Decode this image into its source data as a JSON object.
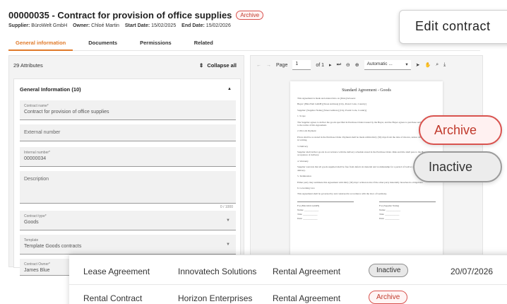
{
  "header": {
    "title": "00000035 - Contract for provision of office supplies",
    "status_badge": "Archive",
    "meta": {
      "supplier_label": "Supplier:",
      "supplier": "BüroWelt GmbH",
      "owner_label": "Owner:",
      "owner": "Chloé Martin",
      "start_label": "Start Date:",
      "start": "15/02/2025",
      "end_label": "End Date:",
      "end": "15/02/2026"
    }
  },
  "tabs": [
    {
      "label": "General information",
      "active": true
    },
    {
      "label": "Documents"
    },
    {
      "label": "Permissions"
    },
    {
      "label": "Related"
    }
  ],
  "left_panel": {
    "attributes_count": "29 Attributes",
    "collapse_label": "Collapse all",
    "section_title": "General Information (10)",
    "fields": {
      "contract_name": {
        "label": "Contract name*",
        "value": "Contract for provision of office supplies"
      },
      "external_number": {
        "placeholder": "External number"
      },
      "internal_number": {
        "label": "Internal number*",
        "value": "00000034"
      },
      "description": {
        "placeholder": "Description",
        "counter": "0 / 1000"
      },
      "contract_type": {
        "label": "Contract type*",
        "value": "Goods"
      },
      "template": {
        "label": "Template",
        "value": "Template Goods contracts"
      },
      "contract_owner": {
        "label": "Contract Owner*",
        "value": "James Blue"
      }
    }
  },
  "pdf_viewer": {
    "page_label": "Page",
    "page_value": "1",
    "of_label": "of 1",
    "zoom_value": "Automatic ...",
    "document": {
      "title": "Standard Agreement - Goods",
      "paragraphs": [
        "This Agreement is made and entered into on [Date] between:",
        "Buyer: [BüroWelt GmbH] [Street Address] [City, Postal Code, Country]",
        "Supplier: [Supplier Name] [Street Address] [City, Postal Code, Country]",
        "1. Scope",
        "The Supplier agrees to deliver the goods specified in Purchase Orders issued by the Buyer, and the Buyer agrees to purchase such goods subject to the terms of this Agreement.",
        "2. Price & Payment",
        "Prices shall be as stated in the Purchase Order. Payment shall be made within thirty (30) days from the date of invoice, unless otherwise agreed in writing.",
        "3. Delivery",
        "Supplier shall deliver goods in accordance with the delivery schedule stated in the Purchase Order. Risk and title shall pass to the Buyer upon acceptance of delivery.",
        "4. Warranty",
        "Supplier warrants that all goods supplied shall be free from defects in material and workmanship for a period of twelve (12) months from delivery.",
        "5. Termination",
        "Either party may terminate this Agreement with thirty (30) days' written notice if the other party materially breaches its obligations.",
        "6. Governing Law",
        "This Agreement shall be governed by and construed in accordance with the laws of Germany."
      ],
      "sign_left": [
        "For [BüroWelt GmbH]",
        "Name: ____________",
        "Title: ____________",
        "Date: ____________"
      ],
      "sign_right": [
        "For [Supplier Name]",
        "Name: ____________",
        "Title: ____________",
        "Date: ____________"
      ]
    }
  },
  "overlay": {
    "edit_contract": "Edit contract",
    "badge_archive": "Archive",
    "badge_inactive": "Inactive"
  },
  "table": {
    "rows": [
      {
        "name": "Lease Agreement",
        "company": "Innovatech Solutions",
        "type": "Rental Agreement",
        "status": "Inactive",
        "date": "20/07/2026"
      },
      {
        "name": "Rental Contract",
        "company": "Horizon Enterprises",
        "type": "Rental Agreement",
        "status": "Archive",
        "date": ""
      }
    ]
  },
  "colors": {
    "accent_orange": "#e07b2b",
    "archive_red": "#d9534f",
    "inactive_gray": "#9a9a9a"
  }
}
